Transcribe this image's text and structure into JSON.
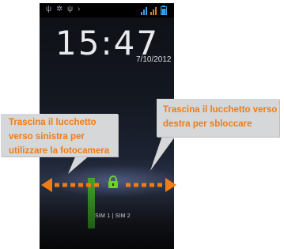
{
  "status_bar": {
    "left_icons": [
      "usb-icon",
      "android-icon",
      "usb-icon",
      "forward-icon"
    ],
    "right_icons": [
      "signal-1-icon",
      "signal-2-icon",
      "battery-icon"
    ]
  },
  "lockscreen": {
    "time": "15:47",
    "date": "7/10/2012",
    "sim_labels": "SIM 1 | SIM 2"
  },
  "callouts": {
    "left": {
      "lines": [
        "Trascina il lucchetto",
        "verso sinistra per",
        "utilizzare la fotocamera"
      ]
    },
    "right": {
      "lines": [
        "Trascina il lucchetto verso",
        "destra per sbloccare"
      ]
    }
  },
  "colors": {
    "arrow_orange": "#f07c14",
    "lock_green": "#6bd02a",
    "callout_bg": "#d6d7d9"
  }
}
